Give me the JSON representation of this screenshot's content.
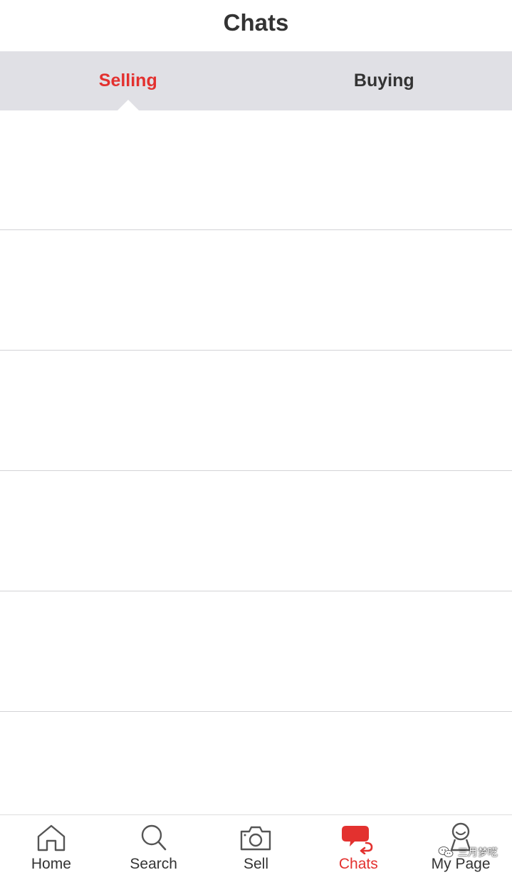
{
  "header": {
    "title": "Chats"
  },
  "tabs": [
    {
      "label": "Selling",
      "active": true
    },
    {
      "label": "Buying",
      "active": false
    }
  ],
  "tabbar": {
    "items": [
      {
        "label": "Home",
        "icon": "house-icon",
        "active": false
      },
      {
        "label": "Search",
        "icon": "magnifier-icon",
        "active": false
      },
      {
        "label": "Sell",
        "icon": "camera-icon",
        "active": false
      },
      {
        "label": "Chats",
        "icon": "chat-bubbles-icon",
        "active": true
      },
      {
        "label": "My Page",
        "icon": "person-icon",
        "active": false
      }
    ]
  },
  "watermark": {
    "text": "三月梦呓",
    "icon": "wechat-icon"
  },
  "colors": {
    "accent": "#e3312f",
    "text": "#333333",
    "tab_background": "#e0e0e5",
    "divider": "#d3d3d6",
    "icon": "#555555"
  }
}
